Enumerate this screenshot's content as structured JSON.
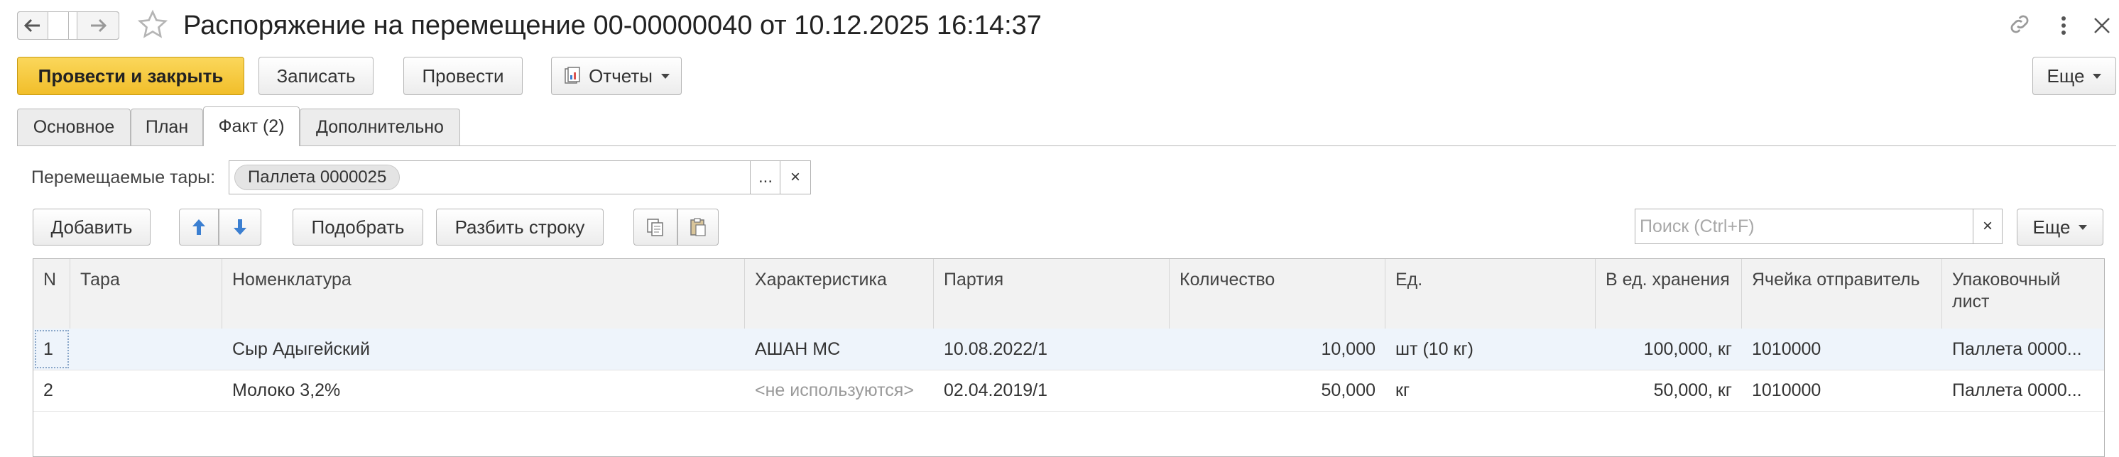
{
  "title": "Распоряжение на перемещение 00-00000040 от 10.12.2025 16:14:37",
  "toolbar": {
    "post_close": "Провести и закрыть",
    "save": "Записать",
    "post": "Провести",
    "reports": "Отчеты",
    "more": "Еще"
  },
  "tabs": [
    "Основное",
    "План",
    "Факт (2)",
    "Дополнительно"
  ],
  "active_tab": "Факт (2)",
  "containers": {
    "label": "Перемещаемые тары:",
    "chip": "Паллета 0000025",
    "pick": "...",
    "clear": "×"
  },
  "table_toolbar": {
    "add": "Добавить",
    "pick": "Подобрать",
    "split": "Разбить строку",
    "search_placeholder": "Поиск (Ctrl+F)",
    "search_clear": "×",
    "more": "Еще"
  },
  "table": {
    "columns": [
      "N",
      "Тара",
      "Номенклатура",
      "Характеристика",
      "Партия",
      "Количество",
      "Ед.",
      "В ед. хранения",
      "Ячейка отправитель",
      "Упаковочный лист"
    ],
    "rows": [
      [
        "1",
        "",
        "Сыр Адыгейский",
        "АШАН МС",
        "10.08.2022/1",
        "10,000",
        "шт (10 кг)",
        "100,000, кг",
        "1010000",
        "Паллета 0000..."
      ],
      [
        "2",
        "",
        "Молоко 3,2%",
        "<не используются>",
        "02.04.2019/1",
        "50,000",
        "кг",
        "50,000, кг",
        "1010000",
        "Паллета 0000..."
      ]
    ]
  },
  "colors": {
    "primary": "#f1be2a",
    "selected_row": "#eef4fb",
    "arrow_blue": "#3b7fd1"
  },
  "icons": [
    "back-arrow-icon",
    "forward-arrow-icon",
    "star-icon",
    "link-icon",
    "kebab-menu-icon",
    "reports-icon",
    "move-up-icon",
    "move-down-icon",
    "copy-icon",
    "paste-icon"
  ]
}
